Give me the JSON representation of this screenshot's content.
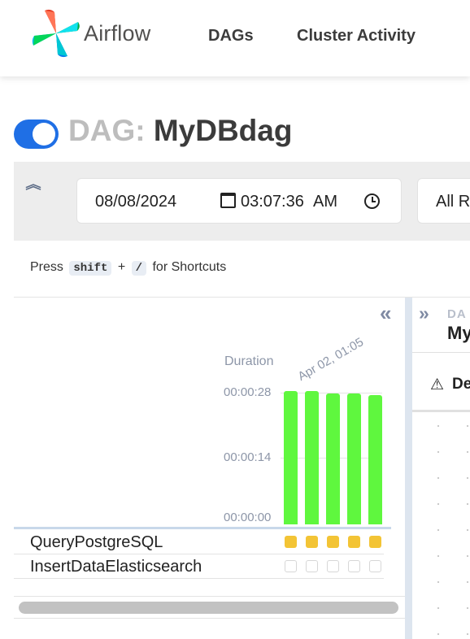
{
  "app": {
    "brand": "Airflow"
  },
  "nav": {
    "dags": "DAGs",
    "cluster_activity": "Cluster Activity"
  },
  "dag": {
    "prefix": "DAG:",
    "name": "MyDBdag",
    "paused": false
  },
  "filters": {
    "date": "08/08/2024",
    "time": "03:07:36",
    "ampm": "AM",
    "run_state": "All R"
  },
  "shortcuts": {
    "press": "Press",
    "key1": "shift",
    "plus": "+",
    "key2": "/",
    "suffix": "for Shortcuts"
  },
  "grid": {
    "duration_label": "Duration",
    "run_date_label": "Apr 02, 01:05",
    "ticks": [
      "00:00:28",
      "00:00:14",
      "00:00:00"
    ],
    "tasks": [
      {
        "name": "QueryPostgreSQL",
        "states": [
          "success",
          "success",
          "success",
          "success",
          "success"
        ]
      },
      {
        "name": "InsertDataElasticsearch",
        "states": [
          "none",
          "none",
          "none",
          "none",
          "none"
        ]
      }
    ]
  },
  "chart_data": {
    "type": "bar",
    "ylabel": "Duration",
    "y_ticks": [
      "00:00:28",
      "00:00:14",
      "00:00:00"
    ],
    "ylim_seconds": [
      0,
      28
    ],
    "values_seconds": [
      28,
      28,
      27.5,
      27.5,
      27.2
    ],
    "color": "#5ff73e"
  },
  "details": {
    "dag_label": "DA",
    "dag_name": "My",
    "tab": "De"
  },
  "colors": {
    "accent": "#1f6fe5",
    "success": "#f3c435",
    "bar": "#5ff73e"
  }
}
